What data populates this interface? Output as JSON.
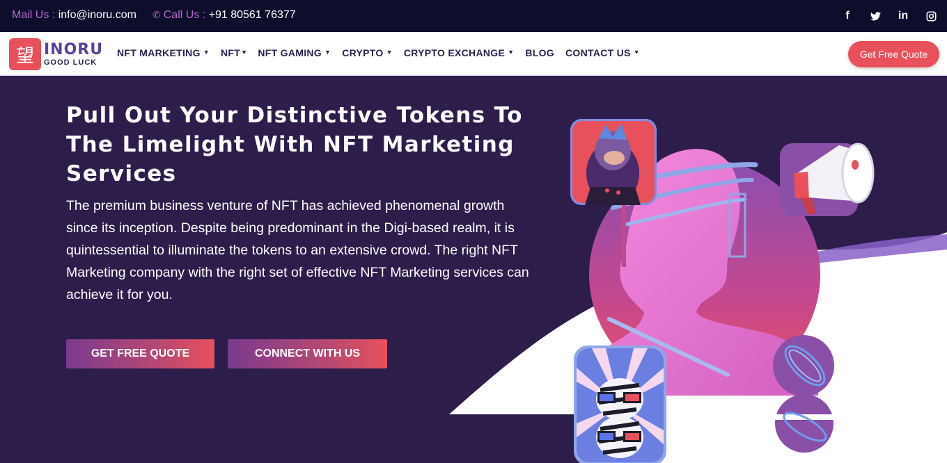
{
  "topbar": {
    "mail_label": "Mail Us :",
    "mail_value": "info@inoru.com",
    "call_label": "Call Us :",
    "call_value": "+91 80561 76377",
    "socials": [
      "facebook-icon",
      "twitter-icon",
      "linkedin-icon",
      "instagram-icon"
    ],
    "social_glyphs": [
      "f",
      "t",
      "in",
      "◎"
    ]
  },
  "brand": {
    "name": "INORU",
    "tagline": "GOOD LUCK",
    "mark_glyph": "望"
  },
  "nav": {
    "items": [
      {
        "label": "NFT MARKETING",
        "has_dropdown": true
      },
      {
        "label": "NFT",
        "has_dropdown": true
      },
      {
        "label": "NFT GAMING",
        "has_dropdown": true
      },
      {
        "label": "CRYPTO",
        "has_dropdown": true
      },
      {
        "label": "CRYPTO EXCHANGE",
        "has_dropdown": true
      },
      {
        "label": "BLOG",
        "has_dropdown": false
      },
      {
        "label": "CONTACT US",
        "has_dropdown": true
      }
    ],
    "cta_label": "Get Free Quote"
  },
  "hero": {
    "title": "Pull Out Your Distinctive Tokens To The Limelight With NFT Marketing Services",
    "body": "The premium business venture of NFT has achieved phenomenal growth since its inception. Despite being predominant in the Digi-based realm, it is quintessential to illuminate the tokens to an extensive crowd. The right NFT Marketing company with the right set of effective NFT Marketing services can achieve it for you.",
    "primary_button": "GET FREE QUOTE",
    "secondary_button": "CONNECT WITH US"
  },
  "colors": {
    "topbar_bg": "#0d0e2b",
    "hero_bg": "#2d1d4b",
    "accent": "#e8505b",
    "brand_purple": "#5b3ea0",
    "label_purple": "#b86ad0"
  }
}
